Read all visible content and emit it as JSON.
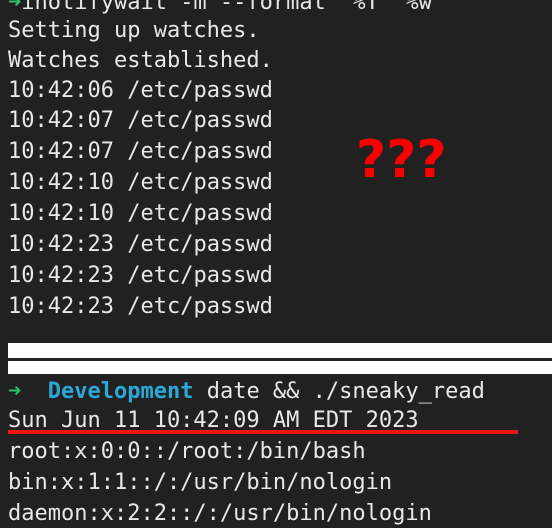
{
  "terminal": {
    "background_color": "#212121",
    "foreground_color": "#e8e8e8",
    "prompt_arrow_color": "#27c46b",
    "prompt_dir_color": "#2aa8d8",
    "annotation_color": "#fb0000",
    "separator_color": "#ffffff"
  },
  "clipped_command": {
    "arrow": "➜",
    "text": "inotifywait -m --format '%T' %w"
  },
  "watch_output": {
    "setting_up": "Setting up watches.",
    "established": "Watches established.",
    "events": [
      {
        "time": "10:42:06",
        "path": "/etc/passwd"
      },
      {
        "time": "10:42:07",
        "path": "/etc/passwd"
      },
      {
        "time": "10:42:07",
        "path": "/etc/passwd"
      },
      {
        "time": "10:42:10",
        "path": "/etc/passwd"
      },
      {
        "time": "10:42:10",
        "path": "/etc/passwd"
      },
      {
        "time": "10:42:23",
        "path": "/etc/passwd"
      },
      {
        "time": "10:42:23",
        "path": "/etc/passwd"
      },
      {
        "time": "10:42:23",
        "path": "/etc/passwd"
      }
    ]
  },
  "annotation": {
    "question_marks": "???"
  },
  "prompt": {
    "arrow": "➜",
    "directory": "Development",
    "command": "date && ./sneaky_read"
  },
  "date_output": {
    "text": "Sun Jun 11 10:42:09 AM EDT 2023"
  },
  "passwd_output": {
    "lines": [
      "root:x:0:0::/root:/bin/bash",
      "bin:x:1:1::/:/usr/bin/nologin",
      "daemon:x:2:2::/:/usr/bin/nologin"
    ]
  }
}
